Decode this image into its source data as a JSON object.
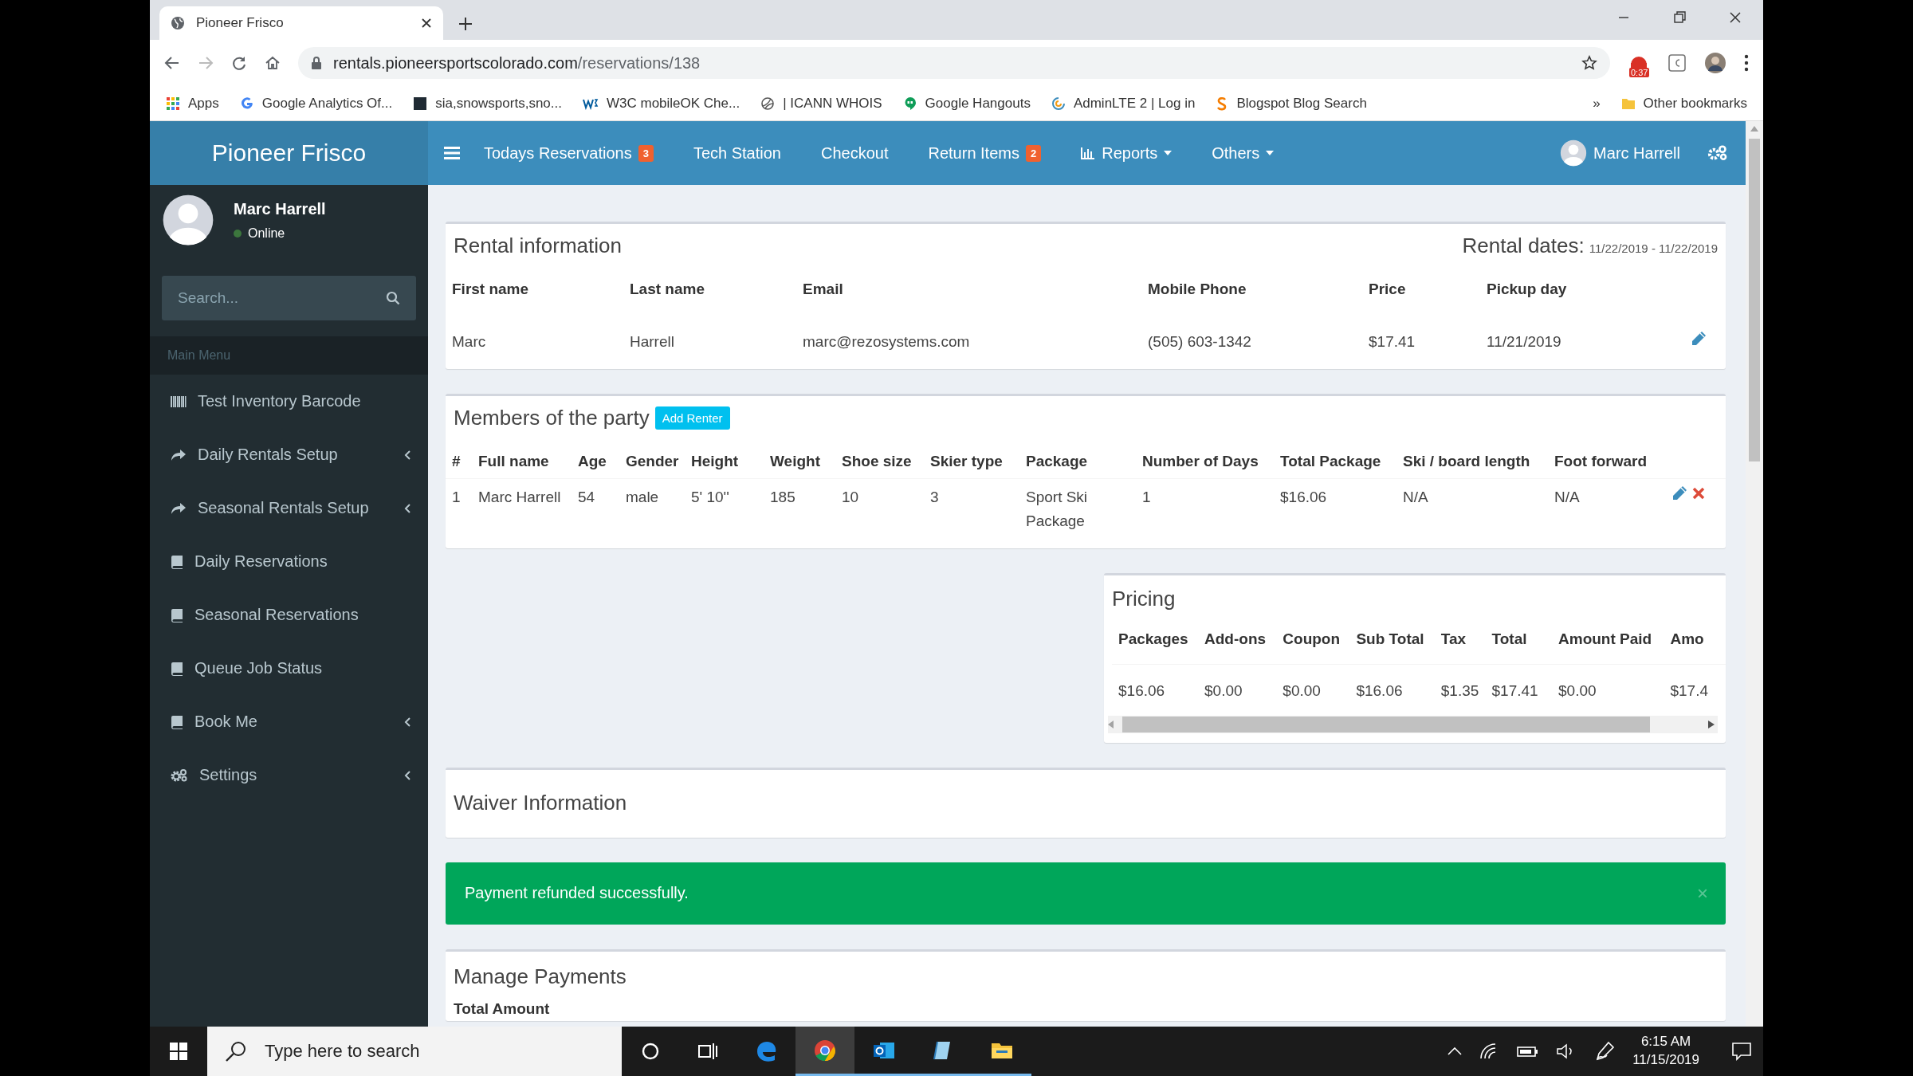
{
  "browser": {
    "tab_title": "Pioneer Frisco",
    "url_host": "rentals.pioneersportscolorado.com",
    "url_path": "/reservations/138",
    "extension_badge": "0:37",
    "bookmarks": [
      {
        "label": "Apps"
      },
      {
        "label": "Google Analytics Of..."
      },
      {
        "label": "sia,snowsports,sno..."
      },
      {
        "label": "W3C mobileOK Che..."
      },
      {
        "label": "| ICANN WHOIS"
      },
      {
        "label": "Google Hangouts"
      },
      {
        "label": "AdminLTE 2 | Log in"
      },
      {
        "label": "Blogspot Blog Search"
      }
    ],
    "overflow": "»",
    "other_bookmarks": "Other bookmarks"
  },
  "header": {
    "logo": "Pioneer Frisco",
    "nav": [
      {
        "label": "Todays Reservations",
        "badge": "3",
        "dropdown": false
      },
      {
        "label": "Tech Station",
        "dropdown": false
      },
      {
        "label": "Checkout",
        "dropdown": false
      },
      {
        "label": "Return Items",
        "badge": "2",
        "dropdown": false
      },
      {
        "label": "Reports",
        "dropdown": true
      },
      {
        "label": "Others",
        "dropdown": true
      }
    ],
    "user": "Marc Harrell"
  },
  "sidebar": {
    "user": {
      "name": "Marc Harrell",
      "status": "Online"
    },
    "search": {
      "placeholder": "Search..."
    },
    "section": "Main Menu",
    "items": [
      {
        "label": "Test Inventory Barcode",
        "expandable": false
      },
      {
        "label": "Daily Rentals Setup",
        "expandable": true
      },
      {
        "label": "Seasonal Rentals Setup",
        "expandable": true
      },
      {
        "label": "Daily Reservations",
        "expandable": false
      },
      {
        "label": "Seasonal Reservations",
        "expandable": false
      },
      {
        "label": "Queue Job Status",
        "expandable": false
      },
      {
        "label": "Book Me",
        "expandable": true
      },
      {
        "label": "Settings",
        "expandable": true
      }
    ]
  },
  "rental": {
    "title": "Rental information",
    "dates_label": "Rental dates:",
    "dates": "11/22/2019 - 11/22/2019",
    "columns": [
      "First name",
      "Last name",
      "Email",
      "Mobile Phone",
      "Price",
      "Pickup day"
    ],
    "row": [
      "Marc",
      "Harrell",
      "marc@rezosystems.com",
      "(505) 603-1342",
      "$17.41",
      "11/21/2019"
    ]
  },
  "party": {
    "title": "Members of the party",
    "add_button": "Add Renter",
    "columns": [
      "#",
      "Full name",
      "Age",
      "Gender",
      "Height",
      "Weight",
      "Shoe size",
      "Skier type",
      "Package",
      "Number of Days",
      "Total Package",
      "Ski / board length",
      "Foot forward"
    ],
    "rows": [
      {
        "cells": [
          "1",
          "Marc Harrell",
          "54",
          "male",
          "5' 10''",
          "185",
          "10",
          "3",
          "Sport Ski Package",
          "1",
          "$16.06",
          "N/A",
          "N/A"
        ]
      }
    ]
  },
  "pricing": {
    "title": "Pricing",
    "columns": [
      "Packages",
      "Add-ons",
      "Coupon",
      "Sub Total",
      "Tax",
      "Total",
      "Amount Paid",
      "Amo"
    ],
    "row": [
      "$16.06",
      "$0.00",
      "$0.00",
      "$16.06",
      "$1.35",
      "$17.41",
      "$0.00",
      "$17.4"
    ]
  },
  "waiver": {
    "title": "Waiver Information"
  },
  "alert": {
    "message": "Payment refunded successfully.",
    "close": "×"
  },
  "payments": {
    "title": "Manage Payments",
    "subtitle": "Total Amount"
  },
  "taskbar": {
    "search_placeholder": "Type here to search",
    "apps": [
      {
        "kind": "edge",
        "selected": false,
        "running": false
      },
      {
        "kind": "chrome",
        "selected": true,
        "running": true
      },
      {
        "kind": "mail",
        "selected": false,
        "running": true
      },
      {
        "kind": "notes",
        "selected": false,
        "running": true
      },
      {
        "kind": "folder",
        "selected": false,
        "running": true
      }
    ],
    "time": "6:15 AM",
    "date": "11/15/2019"
  }
}
